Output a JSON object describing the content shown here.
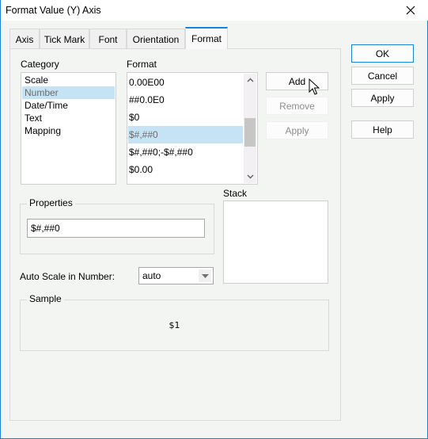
{
  "window": {
    "title": "Format Value (Y) Axis",
    "close_icon": "close-icon",
    "accent_color": "#1883d7"
  },
  "tabs": [
    {
      "label": "Axis",
      "active": false
    },
    {
      "label": "Tick Mark",
      "active": false
    },
    {
      "label": "Font",
      "active": false
    },
    {
      "label": "Orientation",
      "active": false
    },
    {
      "label": "Format",
      "active": true
    }
  ],
  "category": {
    "label": "Category",
    "items": [
      "Scale",
      "Number",
      "Date/Time",
      "Text",
      "Mapping"
    ],
    "selected": "Number"
  },
  "format": {
    "label": "Format",
    "items": [
      "0.00E00",
      "##0.0E0",
      "$0",
      "$#,##0",
      "$#,##0;-$#,##0",
      "$0.00"
    ],
    "selected": "$#,##0",
    "scroll_up_icon": "chevron-up-icon",
    "scroll_down_icon": "chevron-down-icon"
  },
  "format_buttons": {
    "add": "Add",
    "remove": "Remove",
    "apply": "Apply"
  },
  "properties": {
    "label": "Properties",
    "value": "$#,##0"
  },
  "stack": {
    "label": "Stack"
  },
  "auto_scale": {
    "label": "Auto Scale in Number:",
    "value": "auto"
  },
  "sample": {
    "label": "Sample",
    "value": "$1"
  },
  "dialog_buttons": {
    "ok": "OK",
    "cancel": "Cancel",
    "apply": "Apply",
    "help": "Help"
  }
}
